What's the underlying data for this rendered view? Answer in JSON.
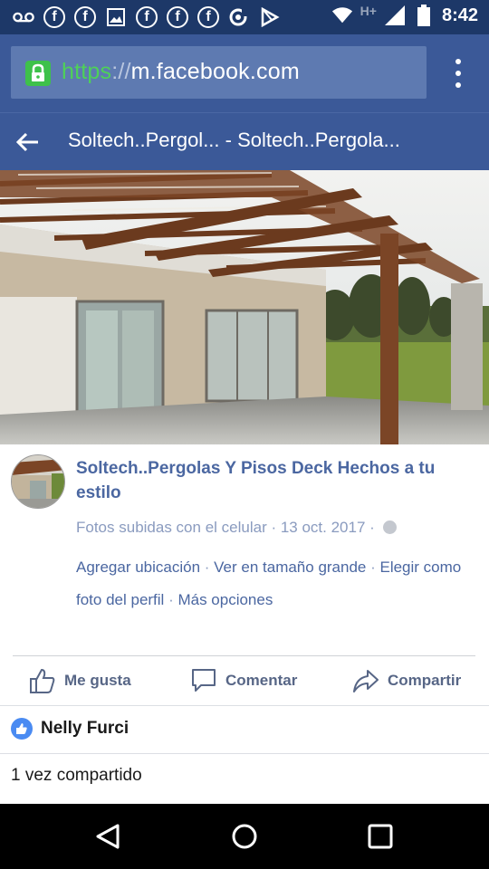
{
  "status_bar": {
    "time": "8:42",
    "network": "H+",
    "notification_icons": [
      "voicemail-icon",
      "facebook-icon",
      "facebook-icon",
      "image-icon",
      "facebook-icon",
      "facebook-icon",
      "facebook-icon",
      "sync-icon",
      "play-store-icon"
    ],
    "system_icons": [
      "wifi-icon",
      "signal-icon",
      "battery-icon"
    ]
  },
  "browser": {
    "url_scheme": "https",
    "url_separator": "://",
    "url_host": "m.facebook.com"
  },
  "header": {
    "title": "Soltech..Pergol... - Soltech..Pergola..."
  },
  "post": {
    "album_title": "Soltech..Pergolas Y Pisos Deck Hechos a tu estilo",
    "album_name": "Fotos subidas con el celular",
    "dot": " · ",
    "date": "13 oct. 2017",
    "links": [
      "Agregar ubicación",
      "Ver en tamaño grande",
      "Elegir como foto del perfil",
      "Más opciones"
    ]
  },
  "actions": {
    "like": "Me gusta",
    "comment": "Comentar",
    "share": "Compartir"
  },
  "reactions": {
    "liker": "Nelly Furci"
  },
  "shares": {
    "text": "1 vez compartido"
  },
  "colors": {
    "facebook_blue": "#3b5998",
    "link_blue": "#4b67a1",
    "status_bar": "#1d3868",
    "secure_green": "#4ed158"
  }
}
